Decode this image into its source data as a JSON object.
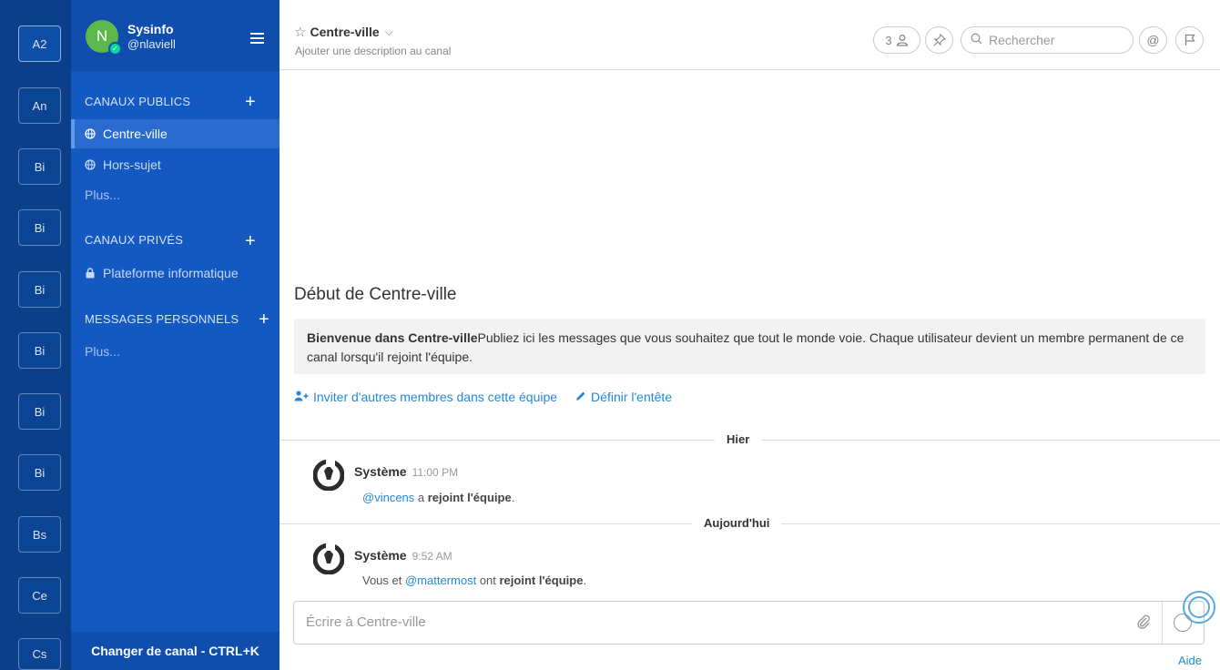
{
  "teams": [
    "A2",
    "An",
    "Bi",
    "Bi",
    "Bi",
    "Bi",
    "Bi",
    "Bi",
    "Bs",
    "Ce",
    "Cs"
  ],
  "sidebar": {
    "avatar_letter": "N",
    "team_name": "Sysinfo",
    "user_handle": "@nlaviell",
    "public_title": "CANAUX PUBLICS",
    "public_channels": [
      "Centre-ville",
      "Hors-sujet"
    ],
    "more_public": "Plus...",
    "private_title": "CANAUX PRIVÉS",
    "private_channels": [
      "Plateforme informatique"
    ],
    "dm_title": "MESSAGES PERSONNELS",
    "more_dm": "Plus...",
    "switcher": "Changer de canal - CTRL+K"
  },
  "header": {
    "channel_name": "Centre-ville",
    "description": "Ajouter une description au canal",
    "member_count": "3",
    "search_placeholder": "Rechercher"
  },
  "intro": {
    "title": "Début de Centre-ville",
    "welcome_bold": "Bienvenue dans Centre-ville",
    "welcome_text": "Publiez ici les messages que vous souhaitez que tout le monde voie. Chaque utilisateur devient un membre permanent de ce canal lorsqu'il rejoint l'équipe.",
    "invite_link": "Inviter d'autres membres dans cette équipe",
    "header_link": "Définir l'entête"
  },
  "separators": [
    "Hier",
    "Aujourd'hui"
  ],
  "posts": [
    {
      "author": "Système",
      "time": "11:00 PM",
      "mention": "@vincens",
      "mid": " a ",
      "action": "rejoint l'équipe",
      "end": "."
    },
    {
      "author": "Système",
      "time": "9:52 AM",
      "prefix": "Vous et ",
      "mention": "@mattermost",
      "mid": " ont ",
      "action": "rejoint l'équipe",
      "end": "."
    }
  ],
  "composer": {
    "placeholder": "Écrire à Centre-ville",
    "help": "Aide"
  },
  "colors": {
    "team_sidebar": "#0b3f8a",
    "channel_sidebar": "#1459c2",
    "link": "#2389d7"
  }
}
